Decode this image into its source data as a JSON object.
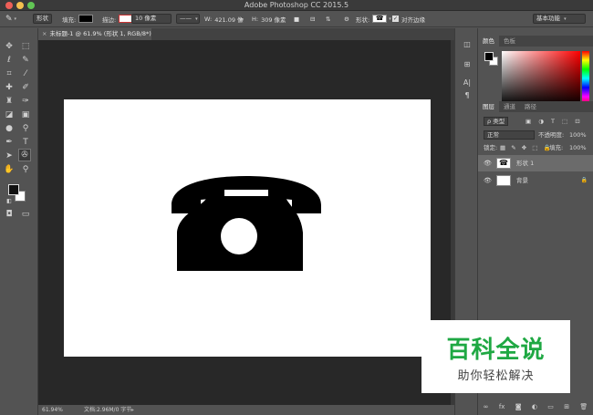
{
  "window": {
    "title": "Adobe Photoshop CC 2015.5"
  },
  "options": {
    "mode": "形状",
    "fill_label": "填充:",
    "stroke_label": "描边:",
    "stroke_width": "10 像素",
    "w_label": "W:",
    "w_value": "421.09 像",
    "h_label": "H:",
    "h_value": "309 像素",
    "shape_label": "形状:",
    "align_edges_label": "对齐边缘",
    "workspace": "基本功能"
  },
  "document_tab": {
    "label": "未标题-1 @ 61.9% (形状 1, RGB/8*) *"
  },
  "status": {
    "zoom": "61.94%",
    "doc_info": "文档:2.96M/0 字节"
  },
  "color_panel": {
    "tabs": [
      "颜色",
      "色板"
    ]
  },
  "layers_panel": {
    "tabs": [
      "图层",
      "通道",
      "路径"
    ],
    "filter_label": "ρ 类型",
    "blend_mode": "正常",
    "opacity_label": "不透明度:",
    "opacity_value": "100%",
    "lock_label": "锁定:",
    "fill_label": "填充:",
    "fill_value": "100%",
    "layers": [
      {
        "name": "形状 1"
      },
      {
        "name": "背景"
      }
    ],
    "bottom_icons": [
      "link-icon",
      "fx-icon",
      "mask-icon",
      "adjustment-icon",
      "folder-icon",
      "new-layer-icon",
      "trash-icon"
    ]
  },
  "watermark": {
    "line1": "百科全说",
    "line2": "助你轻松解决"
  }
}
